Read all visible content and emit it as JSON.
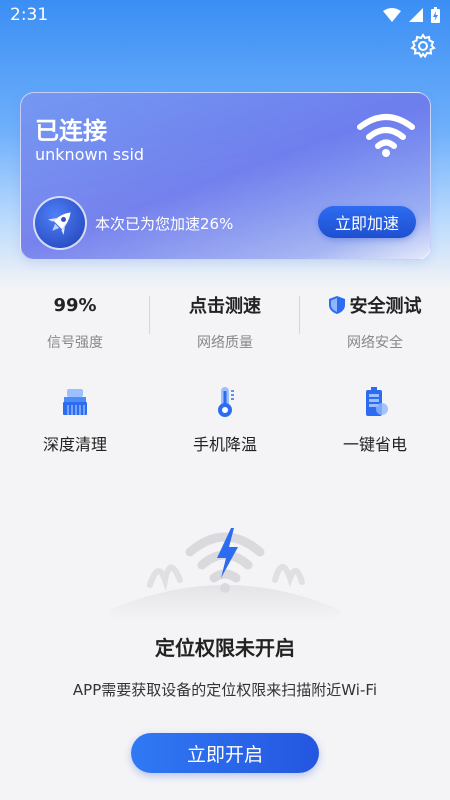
{
  "status_bar": {
    "time": "2:31"
  },
  "header": {
    "settings_icon": "gear-icon"
  },
  "connection_card": {
    "title": "已连接",
    "ssid": "unknown ssid",
    "wifi_icon": "wifi-icon",
    "rocket_icon": "rocket-icon",
    "accel_text": "本次已为您加速26%",
    "accel_button": "立即加速"
  },
  "stats": [
    {
      "value": "99%",
      "label": "信号强度"
    },
    {
      "value": "点击测速",
      "label": "网络质量"
    },
    {
      "value": "安全测试",
      "label": "网络安全",
      "icon": "shield-icon"
    }
  ],
  "tools": [
    {
      "label": "深度清理",
      "icon": "broom-icon"
    },
    {
      "label": "手机降温",
      "icon": "thermometer-icon"
    },
    {
      "label": "一键省电",
      "icon": "battery-icon"
    }
  ],
  "permission": {
    "title": "定位权限未开启",
    "description": "APP需要获取设备的定位权限来扫描附近Wi-Fi",
    "button": "立即开启"
  },
  "colors": {
    "primary": "#2d6cf0",
    "header_top": "#3a8ef4",
    "background": "#f4f4f6"
  }
}
